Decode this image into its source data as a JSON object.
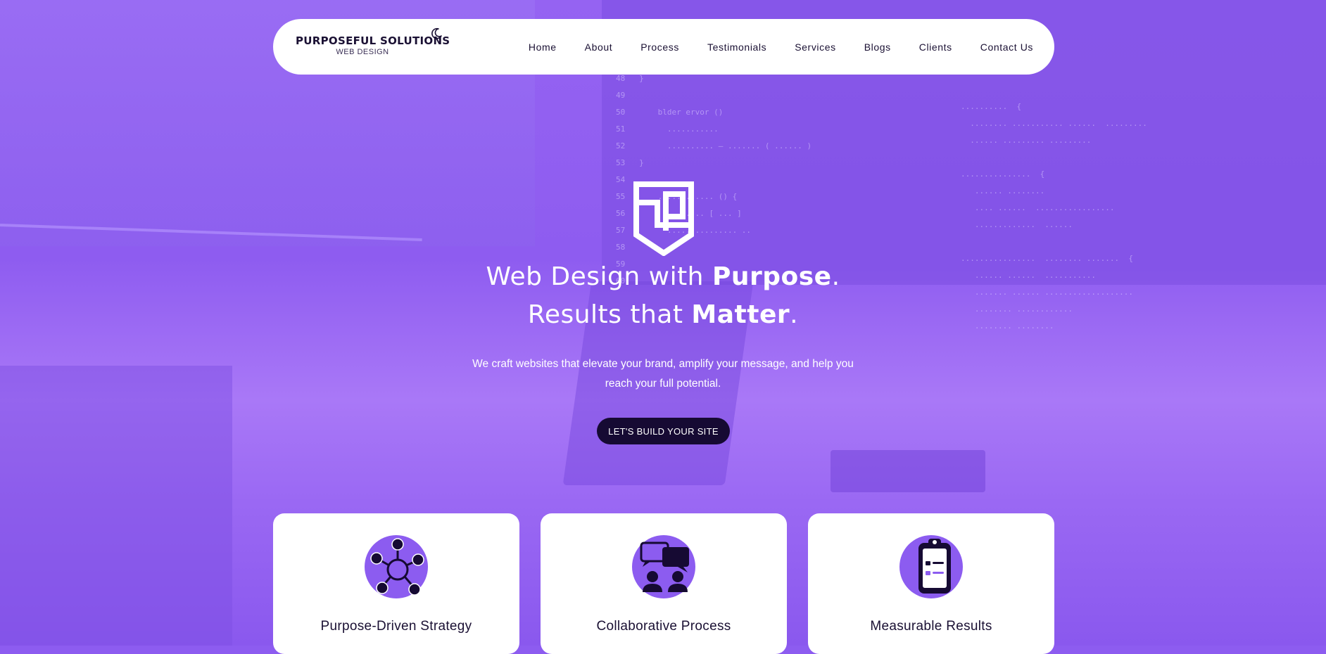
{
  "colors": {
    "accent": "#8c5cf0",
    "dark": "#160a33",
    "text": "#1a1033",
    "white": "#ffffff"
  },
  "nav": {
    "brand_name": "PURPOSEFUL SOLUTIONS",
    "brand_sub": "WEB DESIGN",
    "theme_toggle_icon": "moon-icon",
    "links": [
      "Home",
      "About",
      "Process",
      "Testimonials",
      "Services",
      "Blogs",
      "Clients",
      "Contact Us"
    ]
  },
  "hero": {
    "logo_icon": "ps-monogram-logo",
    "headline_1_normal": "Web Design with ",
    "headline_1_bold": "Purpose",
    "headline_1_end": ".",
    "headline_2_normal": "Results that ",
    "headline_2_bold": "Matter",
    "headline_2_end": ".",
    "subtitle": "We craft websites that elevate your brand, amplify your message, and help you reach your full potential.",
    "cta_label": "LET'S BUILD YOUR SITE"
  },
  "features": [
    {
      "icon": "network-nodes-icon",
      "title": "Purpose-Driven Strategy"
    },
    {
      "icon": "chat-people-icon",
      "title": "Collaborative Process"
    },
    {
      "icon": "clipboard-icon",
      "title": "Measurable Results"
    }
  ]
}
